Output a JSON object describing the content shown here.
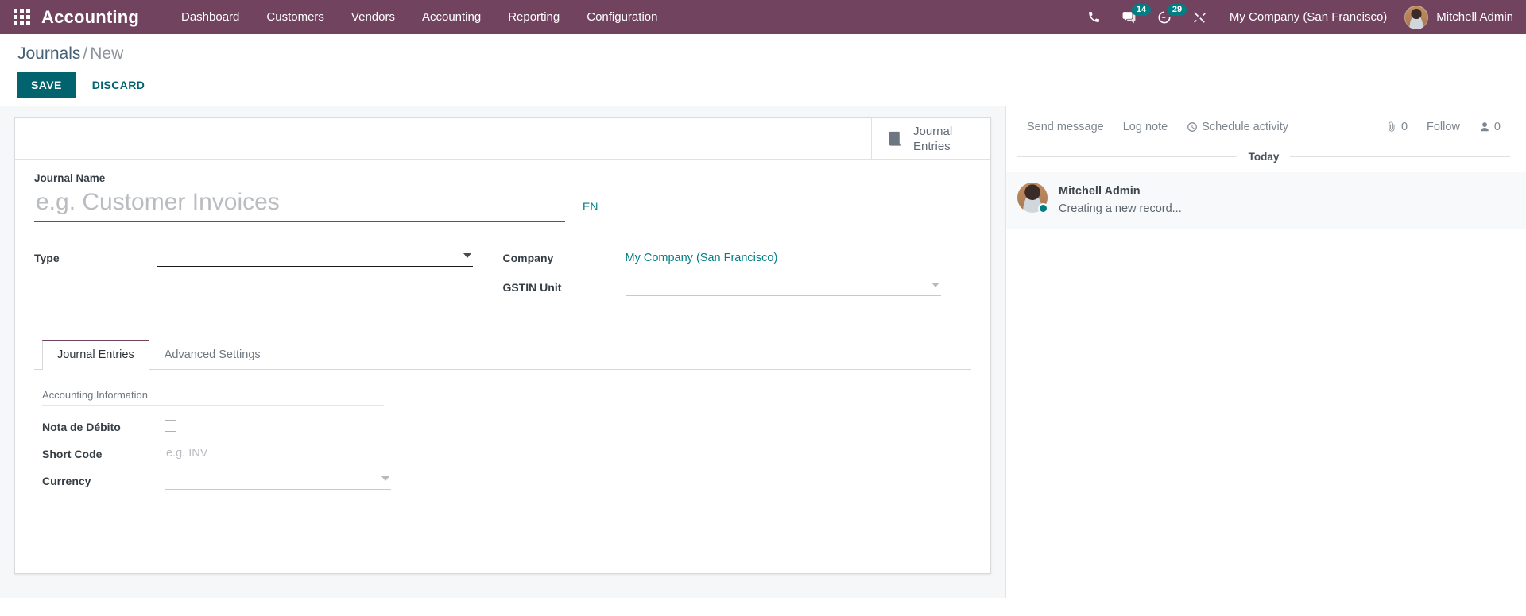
{
  "navbar": {
    "apps_icon": "apps-grid-icon",
    "brand": "Accounting",
    "menu": [
      {
        "label": "Dashboard"
      },
      {
        "label": "Customers"
      },
      {
        "label": "Vendors"
      },
      {
        "label": "Accounting"
      },
      {
        "label": "Reporting"
      },
      {
        "label": "Configuration"
      }
    ],
    "icons": [
      {
        "name": "phone-icon",
        "badge": null
      },
      {
        "name": "messages-icon",
        "badge": "14"
      },
      {
        "name": "activities-clock-icon",
        "badge": "29"
      },
      {
        "name": "developer-tools-icon",
        "badge": null
      }
    ],
    "company": "My Company (San Francisco)",
    "username": "Mitchell Admin",
    "accent_color": "#71435f",
    "badge_color": "#017e84"
  },
  "control_panel": {
    "breadcrumb_root": "Journals",
    "breadcrumb_sep": "/",
    "breadcrumb_current": "New",
    "save_label": "SAVE",
    "discard_label": "DISCARD",
    "save_color": "#00636e"
  },
  "form": {
    "smart_buttons": [
      {
        "icon": "journal-book-icon",
        "label": "Journal Entries"
      }
    ],
    "journal_name": {
      "label": "Journal Name",
      "value": "",
      "placeholder": "e.g. Customer Invoices",
      "lang_badge": "EN"
    },
    "fields_left": [
      {
        "name": "type",
        "label": "Type",
        "value": "",
        "widget": "select"
      }
    ],
    "fields_right": [
      {
        "name": "company",
        "label": "Company",
        "value": "My Company (San Francisco)",
        "widget": "link"
      },
      {
        "name": "gstin_unit",
        "label": "GSTIN Unit",
        "value": "",
        "widget": "select"
      }
    ],
    "tabs": [
      {
        "label": "Journal Entries",
        "active": true
      },
      {
        "label": "Advanced Settings",
        "active": false
      }
    ],
    "section": {
      "title": "Accounting Information",
      "rows": [
        {
          "name": "nota-de-debito",
          "label": "Nota de Débito",
          "widget": "checkbox",
          "checked": false,
          "value": "",
          "placeholder": ""
        },
        {
          "name": "short-code",
          "label": "Short Code",
          "widget": "text",
          "value": "",
          "placeholder": "e.g. INV"
        },
        {
          "name": "currency",
          "label": "Currency",
          "widget": "select",
          "value": "",
          "placeholder": ""
        }
      ]
    }
  },
  "chatter": {
    "send_message": "Send message",
    "log_note": "Log note",
    "schedule_activity": "Schedule activity",
    "attachment_count": "0",
    "follow_label": "Follow",
    "follower_count": "0",
    "date_separator": "Today",
    "messages": [
      {
        "author": "Mitchell Admin",
        "text": "Creating a new record...",
        "status": "online"
      }
    ]
  }
}
